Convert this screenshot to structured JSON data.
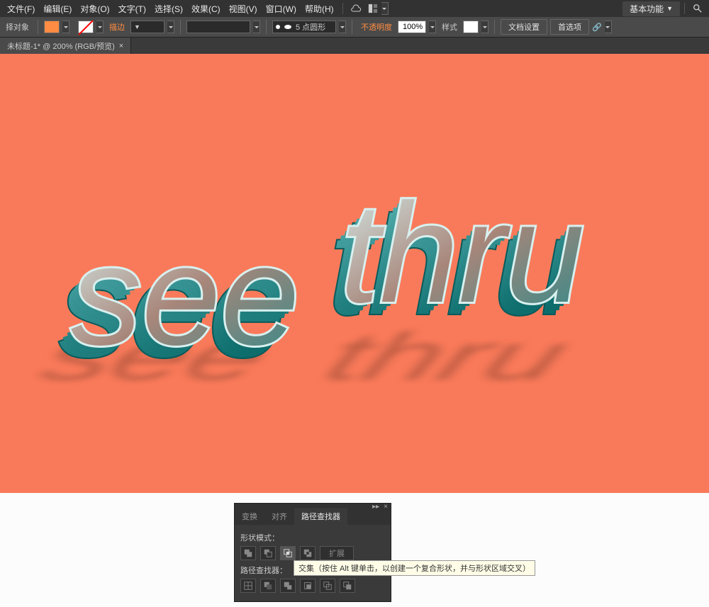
{
  "menubar": {
    "items": [
      "文件(F)",
      "编辑(E)",
      "对象(O)",
      "文字(T)",
      "选择(S)",
      "效果(C)",
      "视图(V)",
      "窗口(W)",
      "帮助(H)"
    ],
    "workspace": "基本功能"
  },
  "toolbar": {
    "context_label": "择对象",
    "stroke_label": "描边",
    "brush_label": "5 点圆形",
    "opacity_label": "不透明度",
    "opacity_value": "100%",
    "style_label": "样式",
    "doc_setup": "文档设置",
    "prefs": "首选项"
  },
  "tab": {
    "title": "未标题-1* @ 200% (RGB/预览)"
  },
  "panel": {
    "tabs": [
      "变换",
      "对齐",
      "路径查找器"
    ],
    "shape_mode_label": "形状模式：",
    "expand_label": "扩展",
    "pathfinder_label": "路径查找器："
  },
  "tooltip": "交集（按住 Alt 键单击，以创建一个复合形状，并与形状区域交叉）",
  "artwork_text": "see thru"
}
